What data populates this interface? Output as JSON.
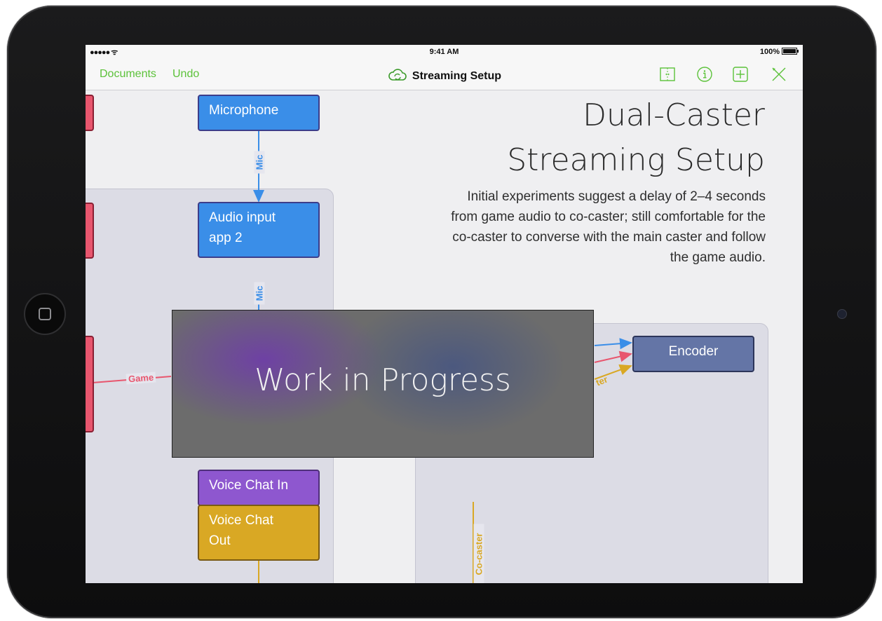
{
  "status_bar": {
    "signal": "●●●●● ᯤ",
    "time": "9:41 AM",
    "battery": "100%"
  },
  "nav": {
    "documents_label": "Documents",
    "undo_label": "Undo",
    "title": "Streaming Setup"
  },
  "document": {
    "title_line1": "Dual-Caster",
    "title_line2": "Streaming Setup",
    "description": "Initial experiments suggest a delay of 2–4 seconds from game audio to co-caster; still comfortable for the co-caster to converse with the main caster and follow the game audio."
  },
  "nodes": {
    "microphone": "Microphone",
    "audio_input_line1": "Audio input",
    "audio_input_line2": "app 2",
    "encoder": "Encoder",
    "voice_chat_in": "Voice Chat In",
    "voice_chat_out_line1": "Voice Chat",
    "voice_chat_out_line2": "Out"
  },
  "edge_labels": {
    "mic_1": "Mic",
    "mic_2": "Mic",
    "game": "Game",
    "caster_partial": "ter",
    "co_caster": "Co-caster"
  },
  "overlay": {
    "text": "Work in Progress"
  },
  "colors": {
    "accent_green": "#5cc23a",
    "node_blue": "#3a8ee8",
    "node_purple": "#8e57cf",
    "node_gold": "#d9a824",
    "node_slate": "#6475a6",
    "node_red": "#e8566e",
    "edge_blue": "#3a8ee8",
    "edge_red": "#e8566e",
    "edge_gold": "#d9a824"
  }
}
